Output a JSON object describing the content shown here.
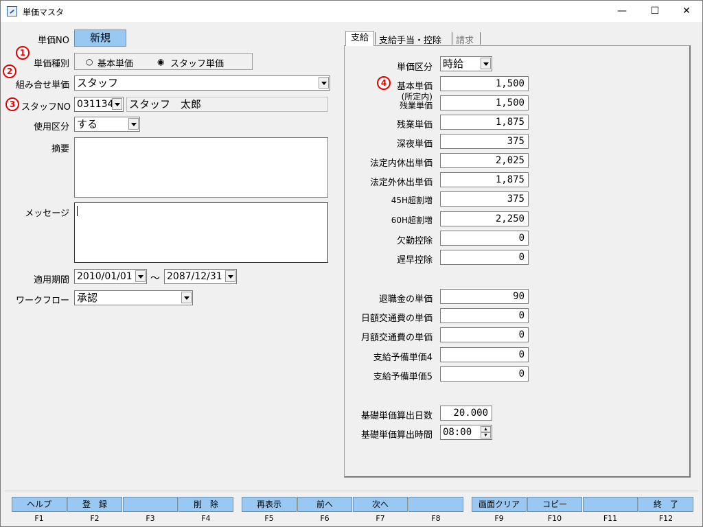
{
  "window": {
    "title": "単価マスタ",
    "minimize": "—",
    "maximize": "☐",
    "close": "✕"
  },
  "left": {
    "unit_no": {
      "label": "単価NO",
      "value": "新規"
    },
    "unit_type": {
      "label": "単価種別",
      "options": [
        "基本単価",
        "スタッフ単価"
      ],
      "selected": "スタッフ単価"
    },
    "combo_unit": {
      "label": "組み合せ単価",
      "value": "スタッフ"
    },
    "staff_no": {
      "label": "スタッフNO",
      "value": "031134",
      "name": "スタッフ　太郎"
    },
    "use_class": {
      "label": "使用区分",
      "value": "する"
    },
    "summary": {
      "label": "摘要",
      "value": ""
    },
    "message": {
      "label": "メッセージ",
      "value": ""
    },
    "period": {
      "label": "適用期間",
      "from": "2010/01/01",
      "tilde": "～",
      "to": "2087/12/31"
    },
    "workflow": {
      "label": "ワークフロー",
      "value": "承認"
    }
  },
  "badges": [
    "1",
    "2",
    "3",
    "4"
  ],
  "tabs": [
    {
      "label": "支給"
    },
    {
      "label": "支給手当・控除"
    },
    {
      "label": "請求"
    }
  ],
  "right": {
    "unit_class": {
      "label": "単価区分",
      "value": "時給"
    },
    "rows1": [
      {
        "label": "基本単価",
        "value": "1,500"
      },
      {
        "label": "(所定内)\n残業単価",
        "value": "1,500"
      },
      {
        "label": "残業単価",
        "value": "1,875"
      },
      {
        "label": "深夜単価",
        "value": "375"
      },
      {
        "label": "法定内休出単価",
        "value": "2,025"
      },
      {
        "label": "法定外休出単価",
        "value": "1,875"
      },
      {
        "label": "45H超割増",
        "value": "375"
      },
      {
        "label": "60H超割増",
        "value": "2,250"
      },
      {
        "label": "欠勤控除",
        "value": "0"
      },
      {
        "label": "遅早控除",
        "value": "0"
      }
    ],
    "rows2": [
      {
        "label": "退職金の単価",
        "value": "90"
      },
      {
        "label": "日額交通費の単価",
        "value": "0"
      },
      {
        "label": "月額交通費の単価",
        "value": "0"
      },
      {
        "label": "支給予備単価4",
        "value": "0"
      },
      {
        "label": "支給予備単価5",
        "value": "0"
      }
    ],
    "base_days": {
      "label": "基礎単価算出日数",
      "value": "20.000"
    },
    "base_time": {
      "label": "基礎単価算出時間",
      "value": "08:00"
    }
  },
  "fkeys": [
    {
      "label": "ヘルプ",
      "key": "F1"
    },
    {
      "label": "登　録",
      "key": "F2"
    },
    {
      "label": "",
      "key": "F3"
    },
    {
      "label": "削　除",
      "key": "F4"
    },
    {
      "label": "再表示",
      "key": "F5"
    },
    {
      "label": "前へ",
      "key": "F6"
    },
    {
      "label": "次へ",
      "key": "F7"
    },
    {
      "label": "",
      "key": "F8"
    },
    {
      "label": "画面クリア",
      "key": "F9"
    },
    {
      "label": "コピー",
      "key": "F10"
    },
    {
      "label": "",
      "key": "F11"
    },
    {
      "label": "終　了",
      "key": "F12"
    }
  ],
  "colors": {
    "fkey_bg": "#99c9f3",
    "badge": "#e60000",
    "new_bg": "#99c9f3"
  }
}
